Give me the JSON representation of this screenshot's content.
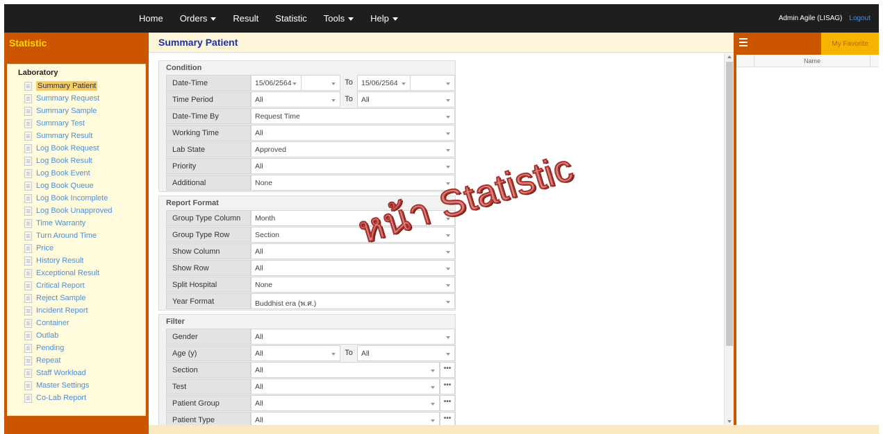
{
  "navbar": {
    "menu": [
      {
        "label": "Home",
        "dropdown": false
      },
      {
        "label": "Orders",
        "dropdown": true
      },
      {
        "label": "Result",
        "dropdown": false
      },
      {
        "label": "Statistic",
        "dropdown": false
      },
      {
        "label": "Tools",
        "dropdown": true
      },
      {
        "label": "Help",
        "dropdown": true
      }
    ],
    "user": "Admin Agile (LISAG)",
    "logout": "Logout"
  },
  "sidebar": {
    "title": "Statistic",
    "section": "Laboratory",
    "items": [
      "Summary Patient",
      "Summary Request",
      "Summary Sample",
      "Summary Test",
      "Summary Result",
      "Log Book Request",
      "Log Book Result",
      "Log Book Event",
      "Log Book Queue",
      "Log Book Incomplete",
      "Log Book Unapproved",
      "Time Warranty",
      "Turn Around Time",
      "Price",
      "History Result",
      "Exceptional Result",
      "Critical Report",
      "Reject Sample",
      "Incident Report",
      "Container",
      "Outlab",
      "Pending",
      "Repeat",
      "Staff Workload",
      "Master Settings",
      "Co-Lab Report"
    ],
    "active_index": 0
  },
  "main": {
    "title": "Summary Patient",
    "condition": {
      "title": "Condition",
      "date_time": {
        "label": "Date-Time",
        "from": "15/06/2564",
        "to_label": "To",
        "to": "15/06/2564"
      },
      "time_period": {
        "label": "Time Period",
        "from": "All",
        "to_label": "To",
        "to": "All"
      },
      "date_time_by": {
        "label": "Date-Time By",
        "value": "Request Time"
      },
      "working_time": {
        "label": "Working Time",
        "value": "All"
      },
      "lab_state": {
        "label": "Lab State",
        "value": "Approved"
      },
      "priority": {
        "label": "Priority",
        "value": "All"
      },
      "additional": {
        "label": "Additional",
        "value": "None"
      }
    },
    "report_format": {
      "title": "Report Format",
      "group_type_column": {
        "label": "Group Type Column",
        "value": "Month"
      },
      "group_type_row": {
        "label": "Group Type Row",
        "value": "Section"
      },
      "show_column": {
        "label": "Show Column",
        "value": "All"
      },
      "show_row": {
        "label": "Show Row",
        "value": "All"
      },
      "split_hospital": {
        "label": "Split Hospital",
        "value": "None"
      },
      "year_format": {
        "label": "Year Format",
        "value": "Buddhist era (พ.ศ.)"
      }
    },
    "filter": {
      "title": "Filter",
      "gender": {
        "label": "Gender",
        "value": "All"
      },
      "age": {
        "label": "Age (y)",
        "from": "All",
        "to_label": "To",
        "to": "All"
      },
      "section": {
        "label": "Section",
        "value": "All"
      },
      "test": {
        "label": "Test",
        "value": "All"
      },
      "patient_group": {
        "label": "Patient Group",
        "value": "All"
      },
      "patient_type": {
        "label": "Patient Type",
        "value": "All"
      }
    }
  },
  "favorites": {
    "tab": "My Favorite",
    "column_name": "Name"
  },
  "overlay_text": "หน้า Statistic",
  "colors": {
    "navbar_bg": "#1e1e1e",
    "sidebar_bg": "#cc5500",
    "sidebar_title": "#ffd800",
    "main_title": "#1a2fa8",
    "link": "#4a8fd8",
    "favorite_tab": "#f5b400"
  }
}
